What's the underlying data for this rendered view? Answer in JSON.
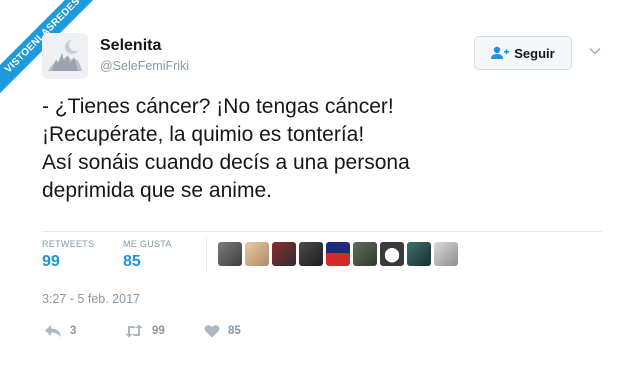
{
  "watermark": {
    "text": "VISTOENLASREDES"
  },
  "user": {
    "name": "Selenita",
    "handle": "@SeleFemiFriki"
  },
  "follow": {
    "label": "Seguir"
  },
  "tweet": {
    "lines": [
      "- ¿Tienes cáncer? ¡No tengas cáncer!",
      "¡Recupérate, la quimio es tontería!",
      "Así sonáis cuando decís a una persona",
      "deprimida que se anime."
    ]
  },
  "stats": {
    "retweets_label": "RETWEETS",
    "retweets_value": "99",
    "likes_label": "ME GUSTA",
    "likes_value": "85"
  },
  "likers_count_shown": 9,
  "timestamp": "3:27 - 5 feb. 2017",
  "actions": {
    "reply_count": "3",
    "retweet_count": "99",
    "like_count": "85"
  },
  "colors": {
    "accent": "#1b95e0",
    "muted": "#8899a6",
    "ribbon": "#1d9bdc"
  }
}
